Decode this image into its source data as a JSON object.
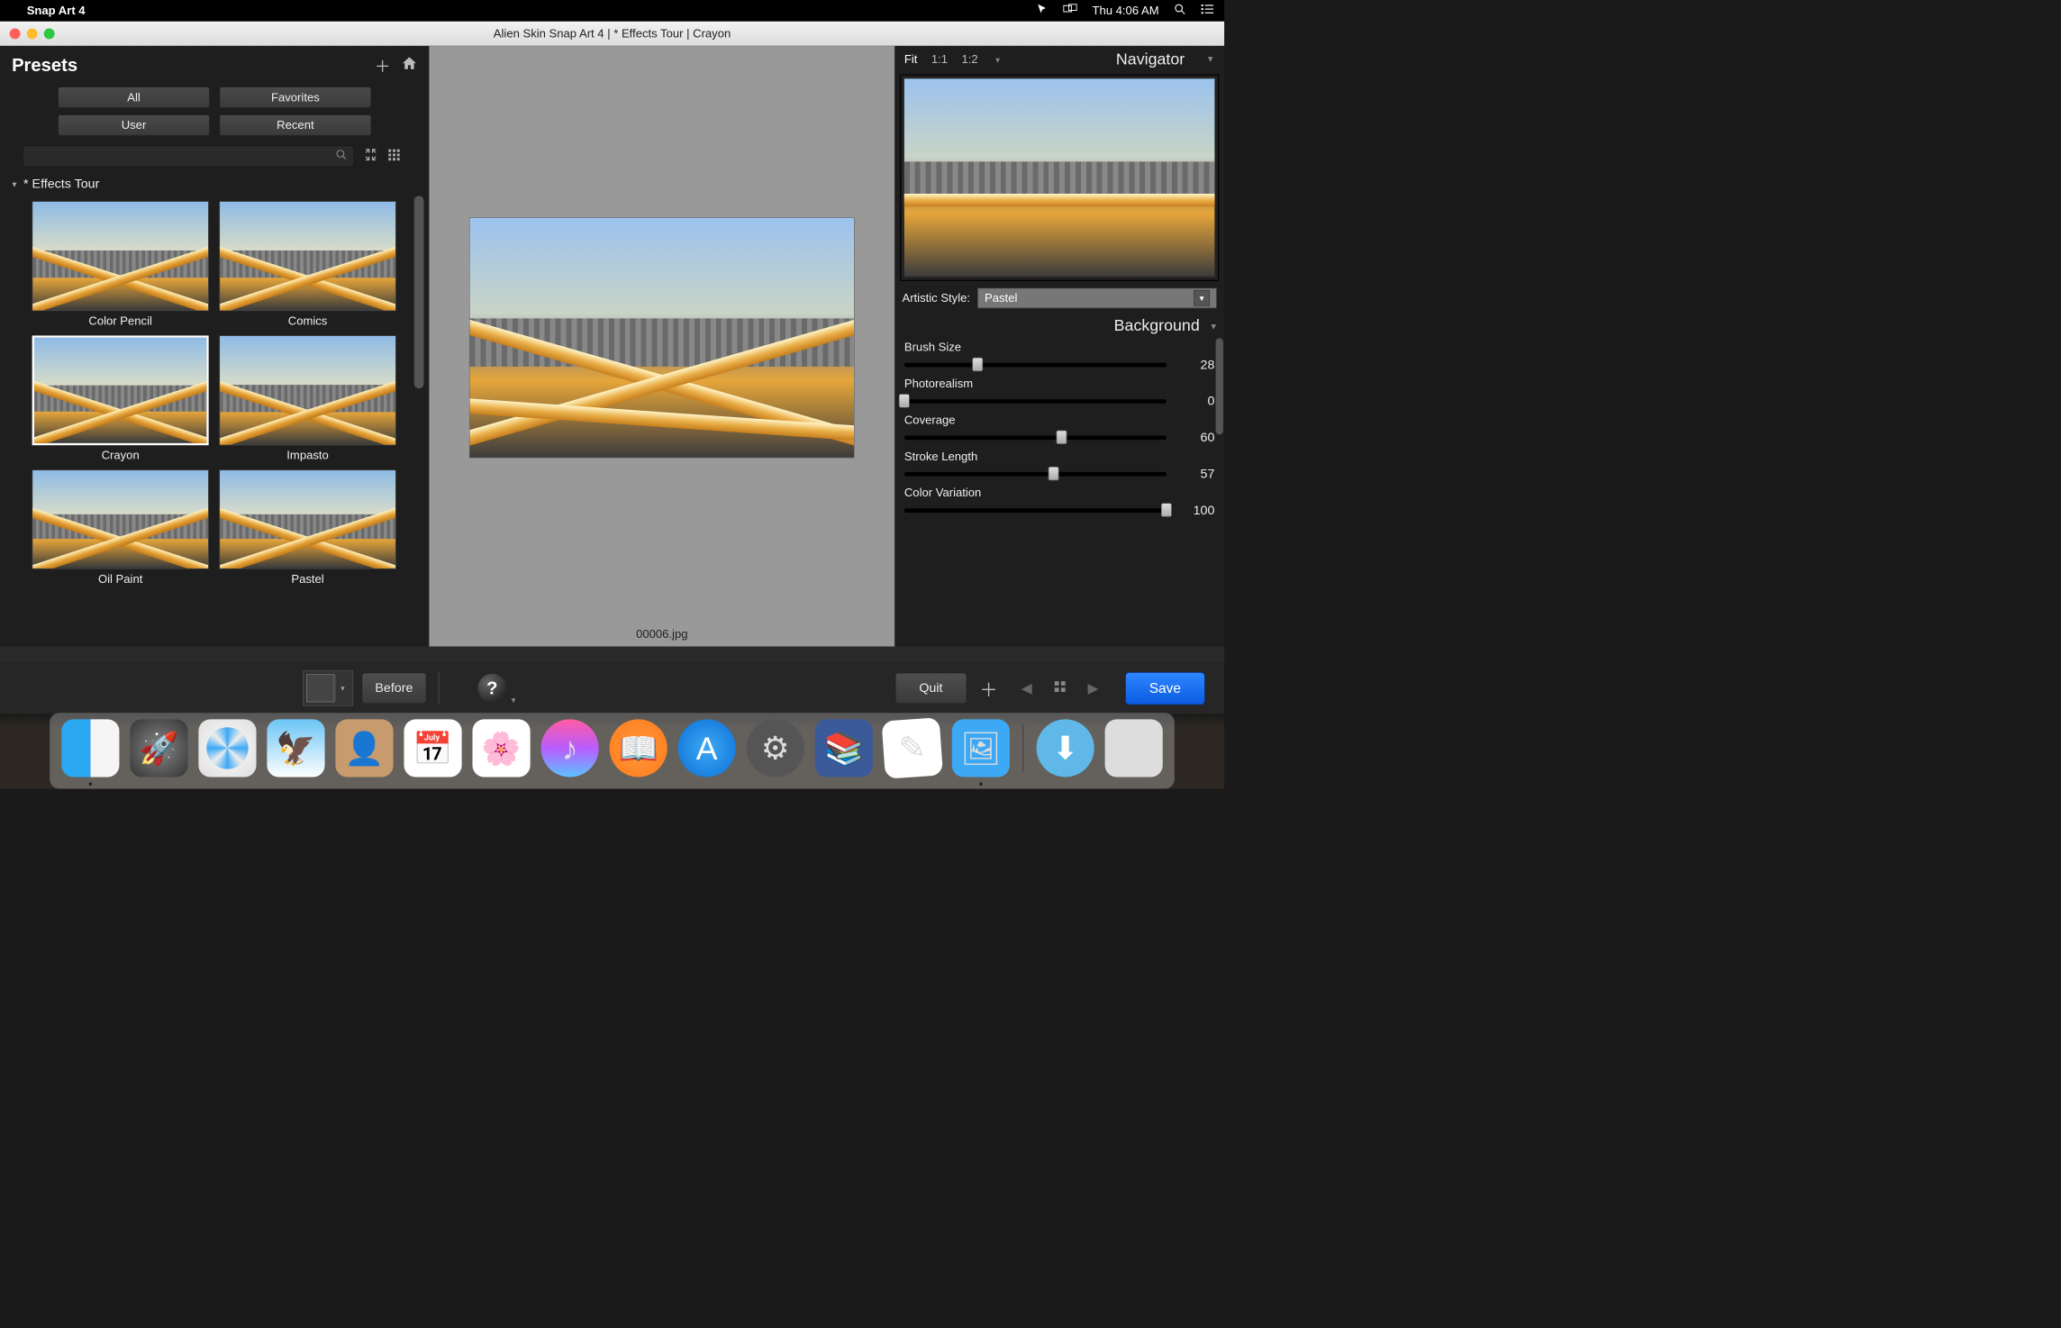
{
  "menubar": {
    "app_name": "Snap Art 4",
    "clock": "Thu 4:06 AM"
  },
  "window": {
    "title": "Alien Skin Snap Art 4 | * Effects Tour | Crayon"
  },
  "presets": {
    "title": "Presets",
    "tabs": {
      "all": "All",
      "favorites": "Favorites",
      "user": "User",
      "recent": "Recent"
    },
    "category": "* Effects Tour",
    "items": [
      {
        "label": "Color Pencil"
      },
      {
        "label": "Comics"
      },
      {
        "label": "Crayon"
      },
      {
        "label": "Impasto"
      },
      {
        "label": "Oil Paint"
      },
      {
        "label": "Pastel"
      }
    ]
  },
  "preview": {
    "filename": "00006.jpg"
  },
  "right": {
    "zoom": {
      "fit": "Fit",
      "one": "1:1",
      "half": "1:2"
    },
    "navigator_title": "Navigator",
    "style_label": "Artistic Style:",
    "style_value": "Pastel",
    "section": "Background",
    "sliders": [
      {
        "label": "Brush Size",
        "value": 28
      },
      {
        "label": "Photorealism",
        "value": 0
      },
      {
        "label": "Coverage",
        "value": 60
      },
      {
        "label": "Stroke Length",
        "value": 57
      },
      {
        "label": "Color Variation",
        "value": 100
      }
    ]
  },
  "footer": {
    "before": "Before",
    "quit": "Quit",
    "save": "Save"
  }
}
